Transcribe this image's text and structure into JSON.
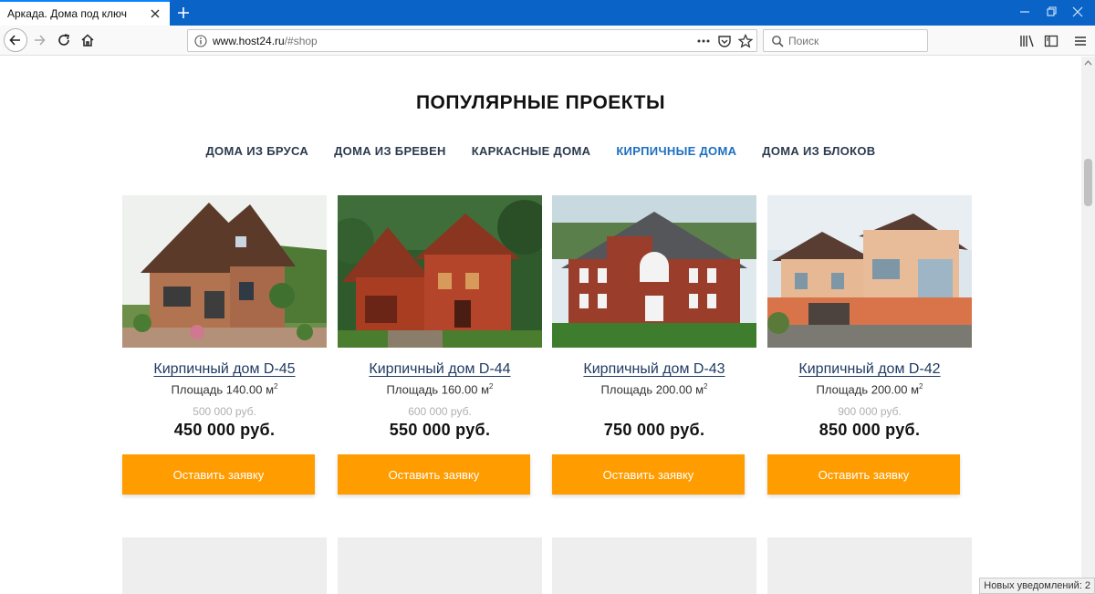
{
  "browser": {
    "tab_title": "Аркада. Дома под ключ",
    "url_domain": "www.host24.ru",
    "url_path": "/#shop",
    "search_placeholder": "Поиск"
  },
  "page": {
    "heading": "ПОПУЛЯРНЫЕ ПРОЕКТЫ",
    "categories": [
      {
        "label": "ДОМА ИЗ БРУСА",
        "active": false
      },
      {
        "label": "ДОМА ИЗ БРЕВЕН",
        "active": false
      },
      {
        "label": "КАРКАСНЫЕ ДОМА",
        "active": false
      },
      {
        "label": "КИРПИЧНЫЕ ДОМА",
        "active": true
      },
      {
        "label": "ДОМА ИЗ БЛОКОВ",
        "active": false
      }
    ],
    "active_color": "#1d6fc2",
    "button_color": "#ff9c00",
    "products": [
      {
        "name": "Кирпичный дом D-45",
        "area": "Площадь 140.00 м",
        "area_unit_sup": "2",
        "old_price": "500 000 руб.",
        "price": "450 000 руб.",
        "button": "Оставить заявку"
      },
      {
        "name": "Кирпичный дом D-44",
        "area": "Площадь 160.00 м",
        "area_unit_sup": "2",
        "old_price": "600 000 руб.",
        "price": "550 000 руб.",
        "button": "Оставить заявку"
      },
      {
        "name": "Кирпичный дом D-43",
        "area": "Площадь 200.00 м",
        "area_unit_sup": "2",
        "old_price": "",
        "price": "750 000 руб.",
        "button": "Оставить заявку"
      },
      {
        "name": "Кирпичный дом D-42",
        "area": "Площадь 200.00 м",
        "area_unit_sup": "2",
        "old_price": "900 000 руб.",
        "price": "850 000 руб.",
        "button": "Оставить заявку"
      }
    ]
  },
  "status_bar": "Новых уведомлений: 2"
}
